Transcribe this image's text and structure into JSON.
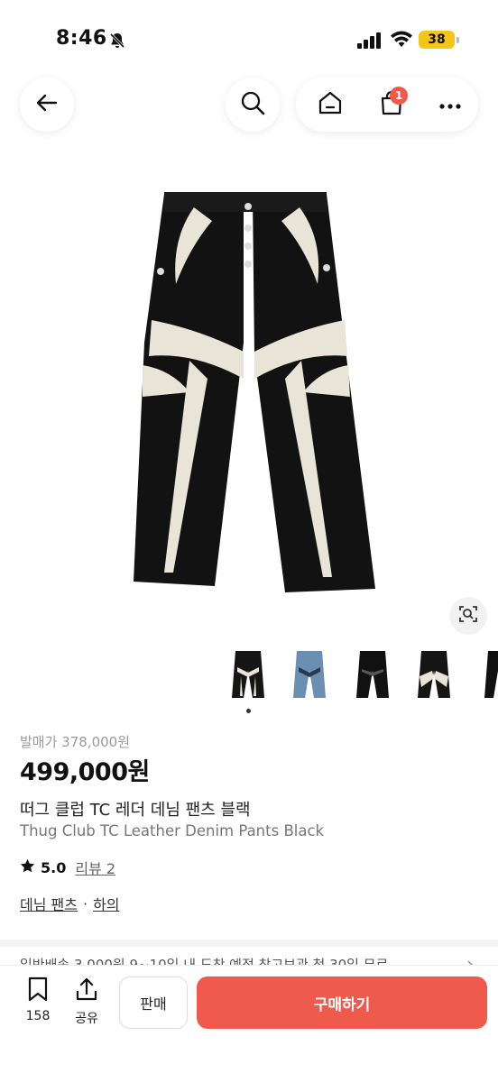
{
  "status_bar": {
    "time": "8:46",
    "battery": "38"
  },
  "nav": {
    "icons": [
      "arrow-left-icon",
      "search-icon",
      "home-icon",
      "shopping-bag-icon",
      "more-icon"
    ],
    "cart_badge": "1"
  },
  "product": {
    "original_price": "발매가 378,000원",
    "price": "499,000원",
    "name_ko": "떠그 클럽 TC 레더 데님 팬츠 블랙",
    "name_en": "Thug Club TC Leather Denim Pants Black",
    "rating": "5.0",
    "review_link": "리뷰 2",
    "category_1": "데님 팬츠",
    "category_sep": "·",
    "category_2": "하의"
  },
  "shipping_peek": "일반배송 3,000원 9~10일 내 도착 예정        창고보관 첫 30일 무료",
  "bottom_bar": {
    "bookmark_count": "158",
    "share_label": "공유",
    "sell_label": "판매",
    "buy_label": "구매하기"
  },
  "colors": {
    "accent": "#ef5a4c",
    "badge": "#f05a4a",
    "battery": "#f5c518"
  }
}
